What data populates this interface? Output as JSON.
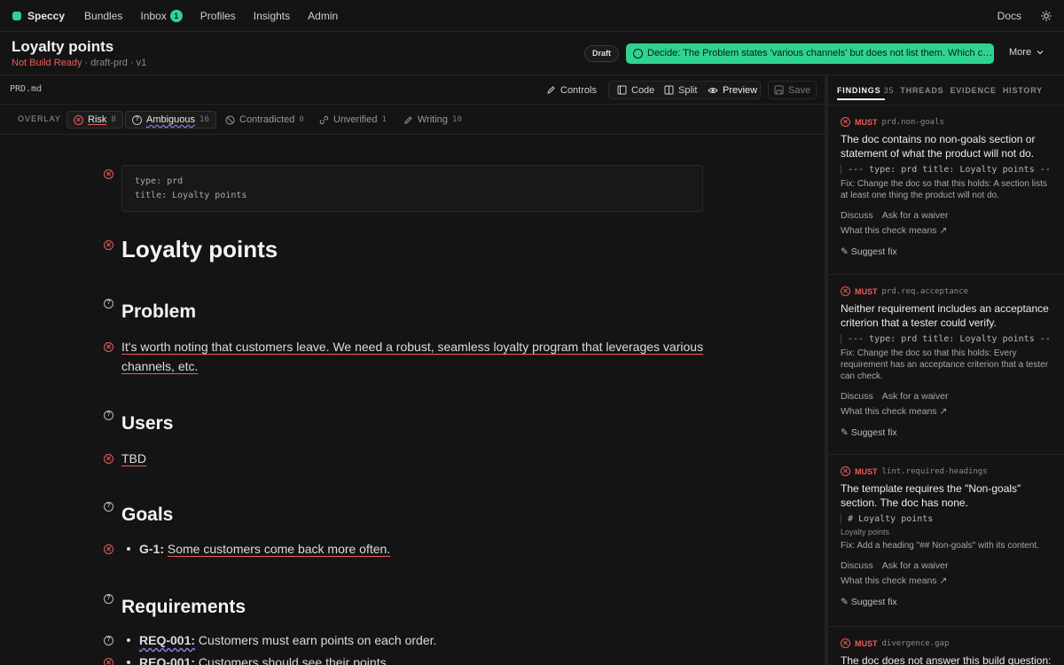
{
  "nav": {
    "brand": "Speccy",
    "items": [
      {
        "label": "Bundles"
      },
      {
        "label": "Inbox",
        "count": "1"
      },
      {
        "label": "Profiles"
      },
      {
        "label": "Insights"
      },
      {
        "label": "Admin"
      }
    ],
    "docs": "Docs"
  },
  "header": {
    "title": "Loyalty points",
    "status": "Not Build Ready",
    "meta": " · draft-prd · v1",
    "draft": "Draft",
    "decide": "Decide: The Problem states 'various channels' but does not list them. Which channels?",
    "more": "More"
  },
  "toolbar": {
    "filename": "PRD.md",
    "controls": "Controls",
    "code": "Code",
    "split": "Split",
    "preview": "Preview",
    "save": "Save"
  },
  "overlay": {
    "label": "OVERLAY",
    "chips": [
      {
        "label": "Risk",
        "count": "8"
      },
      {
        "label": "Ambiguous",
        "count": "16"
      },
      {
        "label": "Contradicted",
        "count": "0"
      },
      {
        "label": "Unverified",
        "count": "1"
      },
      {
        "label": "Writing",
        "count": "10"
      }
    ]
  },
  "doc": {
    "frontmatter_line1": "type: prd",
    "frontmatter_line2": "title: Loyalty points",
    "h1": "Loyalty points",
    "problem_heading": "Problem",
    "problem_text_line1": "It's worth noting that customers leave. We need a robust, seamless loyalty program that leverages various",
    "problem_text_line2": "channels, etc.",
    "users_heading": "Users",
    "users_text": "TBD",
    "goals_heading": "Goals",
    "goal_id": "G-1:",
    "goal_text": "Some customers come back more often.",
    "requirements_heading": "Requirements",
    "req1_id": "REQ-001:",
    "req1_text": " Customers must earn points on each order.",
    "req2_id": "REQ-001:",
    "req2_text": " Customers should see their points."
  },
  "panel": {
    "tabs": [
      {
        "label": "FINDINGS",
        "count": "35"
      },
      {
        "label": "THREADS"
      },
      {
        "label": "EVIDENCE"
      },
      {
        "label": "HISTORY"
      }
    ],
    "discuss": "Discuss",
    "waiver": "Ask for a waiver",
    "means": "What this check means",
    "suggest": "Suggest fix",
    "findings": [
      {
        "severity": "MUST",
        "rule": "prd.non-goals",
        "message": "The doc contains no non-goals section or statement of what the product will not do.",
        "quote": "--- type: prd title: Loyalty points ---",
        "fix": "Fix: Change the doc so that this holds: A section lists at least one thing the product will not do."
      },
      {
        "severity": "MUST",
        "rule": "prd.req.acceptance",
        "message": "Neither requirement includes an acceptance criterion that a tester could verify.",
        "quote": "--- type: prd title: Loyalty points ---",
        "fix": "Fix: Change the doc so that this holds: Every requirement has an acceptance criterion that a tester can check."
      },
      {
        "severity": "MUST",
        "rule": "lint.required-headings",
        "message": "The template requires the \"Non-goals\" section. The doc has none.",
        "quote": "# Loyalty points",
        "quote_sub": "Loyalty points",
        "fix": "Fix: Add a heading \"## Non-goals\" with its content."
      },
      {
        "severity": "MUST",
        "rule": "divergence.gap",
        "message": "The doc does not answer this build question:"
      }
    ]
  },
  "colors": {
    "accent": "#2fd391",
    "risk": "#ef5b5b",
    "ambiguous": "#8f7cf0",
    "background": "#141414"
  }
}
